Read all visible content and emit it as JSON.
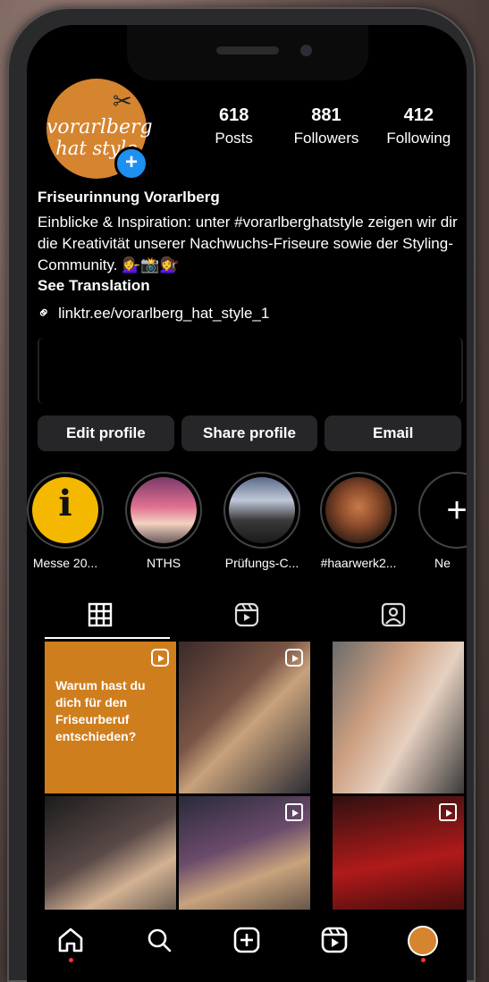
{
  "profile": {
    "avatar_line1": "vorarlberg",
    "avatar_line2": "hat style",
    "stats": [
      {
        "num": "618",
        "label": "Posts"
      },
      {
        "num": "881",
        "label": "Followers"
      },
      {
        "num": "412",
        "label": "Following"
      }
    ],
    "name": "Friseurinnung Vorarlberg",
    "bio": "Einblicke & Inspiration: unter #vorarlberghatstyle zeigen wir dir die Kreativität unserer Nachwuchs-Friseure sowie der Styling-Community. 💁‍♀️📸💇‍♀️",
    "see_translation": "See Translation",
    "link": "linktr.ee/vorarlberg_hat_style_1"
  },
  "buttons": {
    "edit": "Edit profile",
    "share": "Share profile",
    "email": "Email"
  },
  "highlights": [
    {
      "label": "Messe 20..."
    },
    {
      "label": "NTHS"
    },
    {
      "label": "Prüfungs-C..."
    },
    {
      "label": "#haarwerk2..."
    },
    {
      "label": "Ne"
    }
  ],
  "grid": {
    "post1_text": "Warum hast du dich für den Friseurberuf entschieden?"
  },
  "colors": {
    "accent_orange": "#d5842f",
    "badge_blue": "#1e90f0",
    "button_bg": "#262628",
    "notification_red": "#ff3040"
  }
}
